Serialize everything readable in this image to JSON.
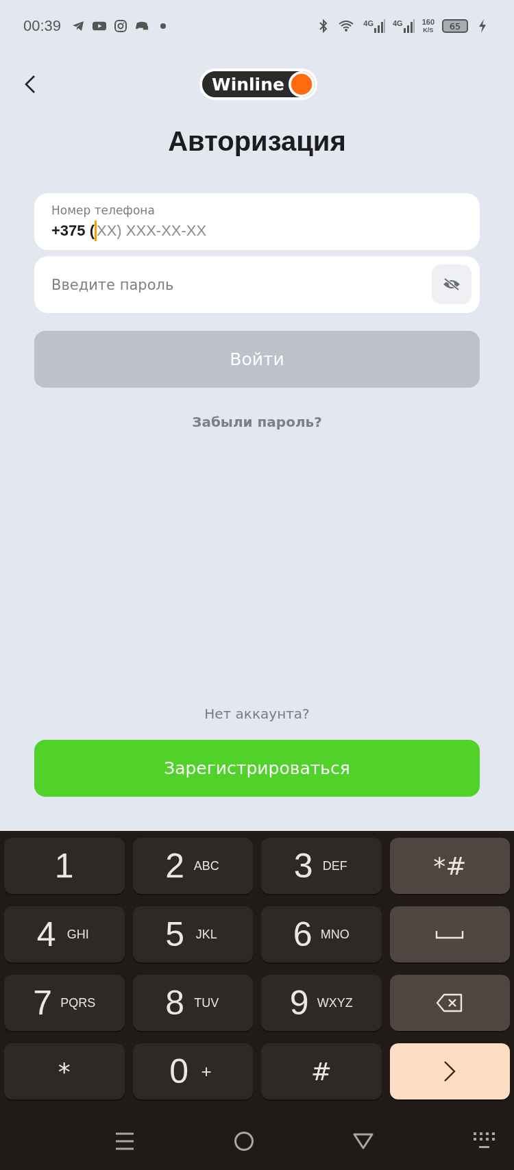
{
  "status_bar": {
    "time": "00:39",
    "network_1": "4G",
    "network_2": "4G",
    "speed_value": "160",
    "speed_unit": "K/S",
    "battery": "65",
    "charging": true
  },
  "header": {
    "logo": "Winline"
  },
  "title": "Авторизация",
  "phone_field": {
    "label": "Номер телефона",
    "value": "+375 (",
    "mask": "XX) XXX-XX-XX",
    "focused": true
  },
  "password_field": {
    "placeholder": "Введите пароль",
    "visible": false
  },
  "login_button": {
    "label": "Войти",
    "disabled": true
  },
  "forgot_link": "Забыли пароль?",
  "no_account": "Нет аккаунта?",
  "register_button": {
    "label": "Зарегистрироваться"
  },
  "keyboard": {
    "rows": [
      [
        {
          "kind": "digit",
          "main": "1"
        },
        {
          "kind": "digit",
          "main": "2",
          "sub": "ABC"
        },
        {
          "kind": "digit",
          "main": "3",
          "sub": "DEF"
        },
        {
          "kind": "symbols",
          "main": "*#"
        }
      ],
      [
        {
          "kind": "digit",
          "main": "4",
          "sub": "GHI"
        },
        {
          "kind": "digit",
          "main": "5",
          "sub": "JKL"
        },
        {
          "kind": "digit",
          "main": "6",
          "sub": "MNO"
        },
        {
          "kind": "space"
        }
      ],
      [
        {
          "kind": "digit",
          "main": "7",
          "sub": "PQRS"
        },
        {
          "kind": "digit",
          "main": "8",
          "sub": "TUV"
        },
        {
          "kind": "digit",
          "main": "9",
          "sub": "WXYZ"
        },
        {
          "kind": "backspace"
        }
      ],
      [
        {
          "kind": "symbol",
          "main": "*"
        },
        {
          "kind": "digit",
          "main": "0",
          "sub": "+"
        },
        {
          "kind": "symbol",
          "main": "#"
        },
        {
          "kind": "next"
        }
      ]
    ]
  }
}
